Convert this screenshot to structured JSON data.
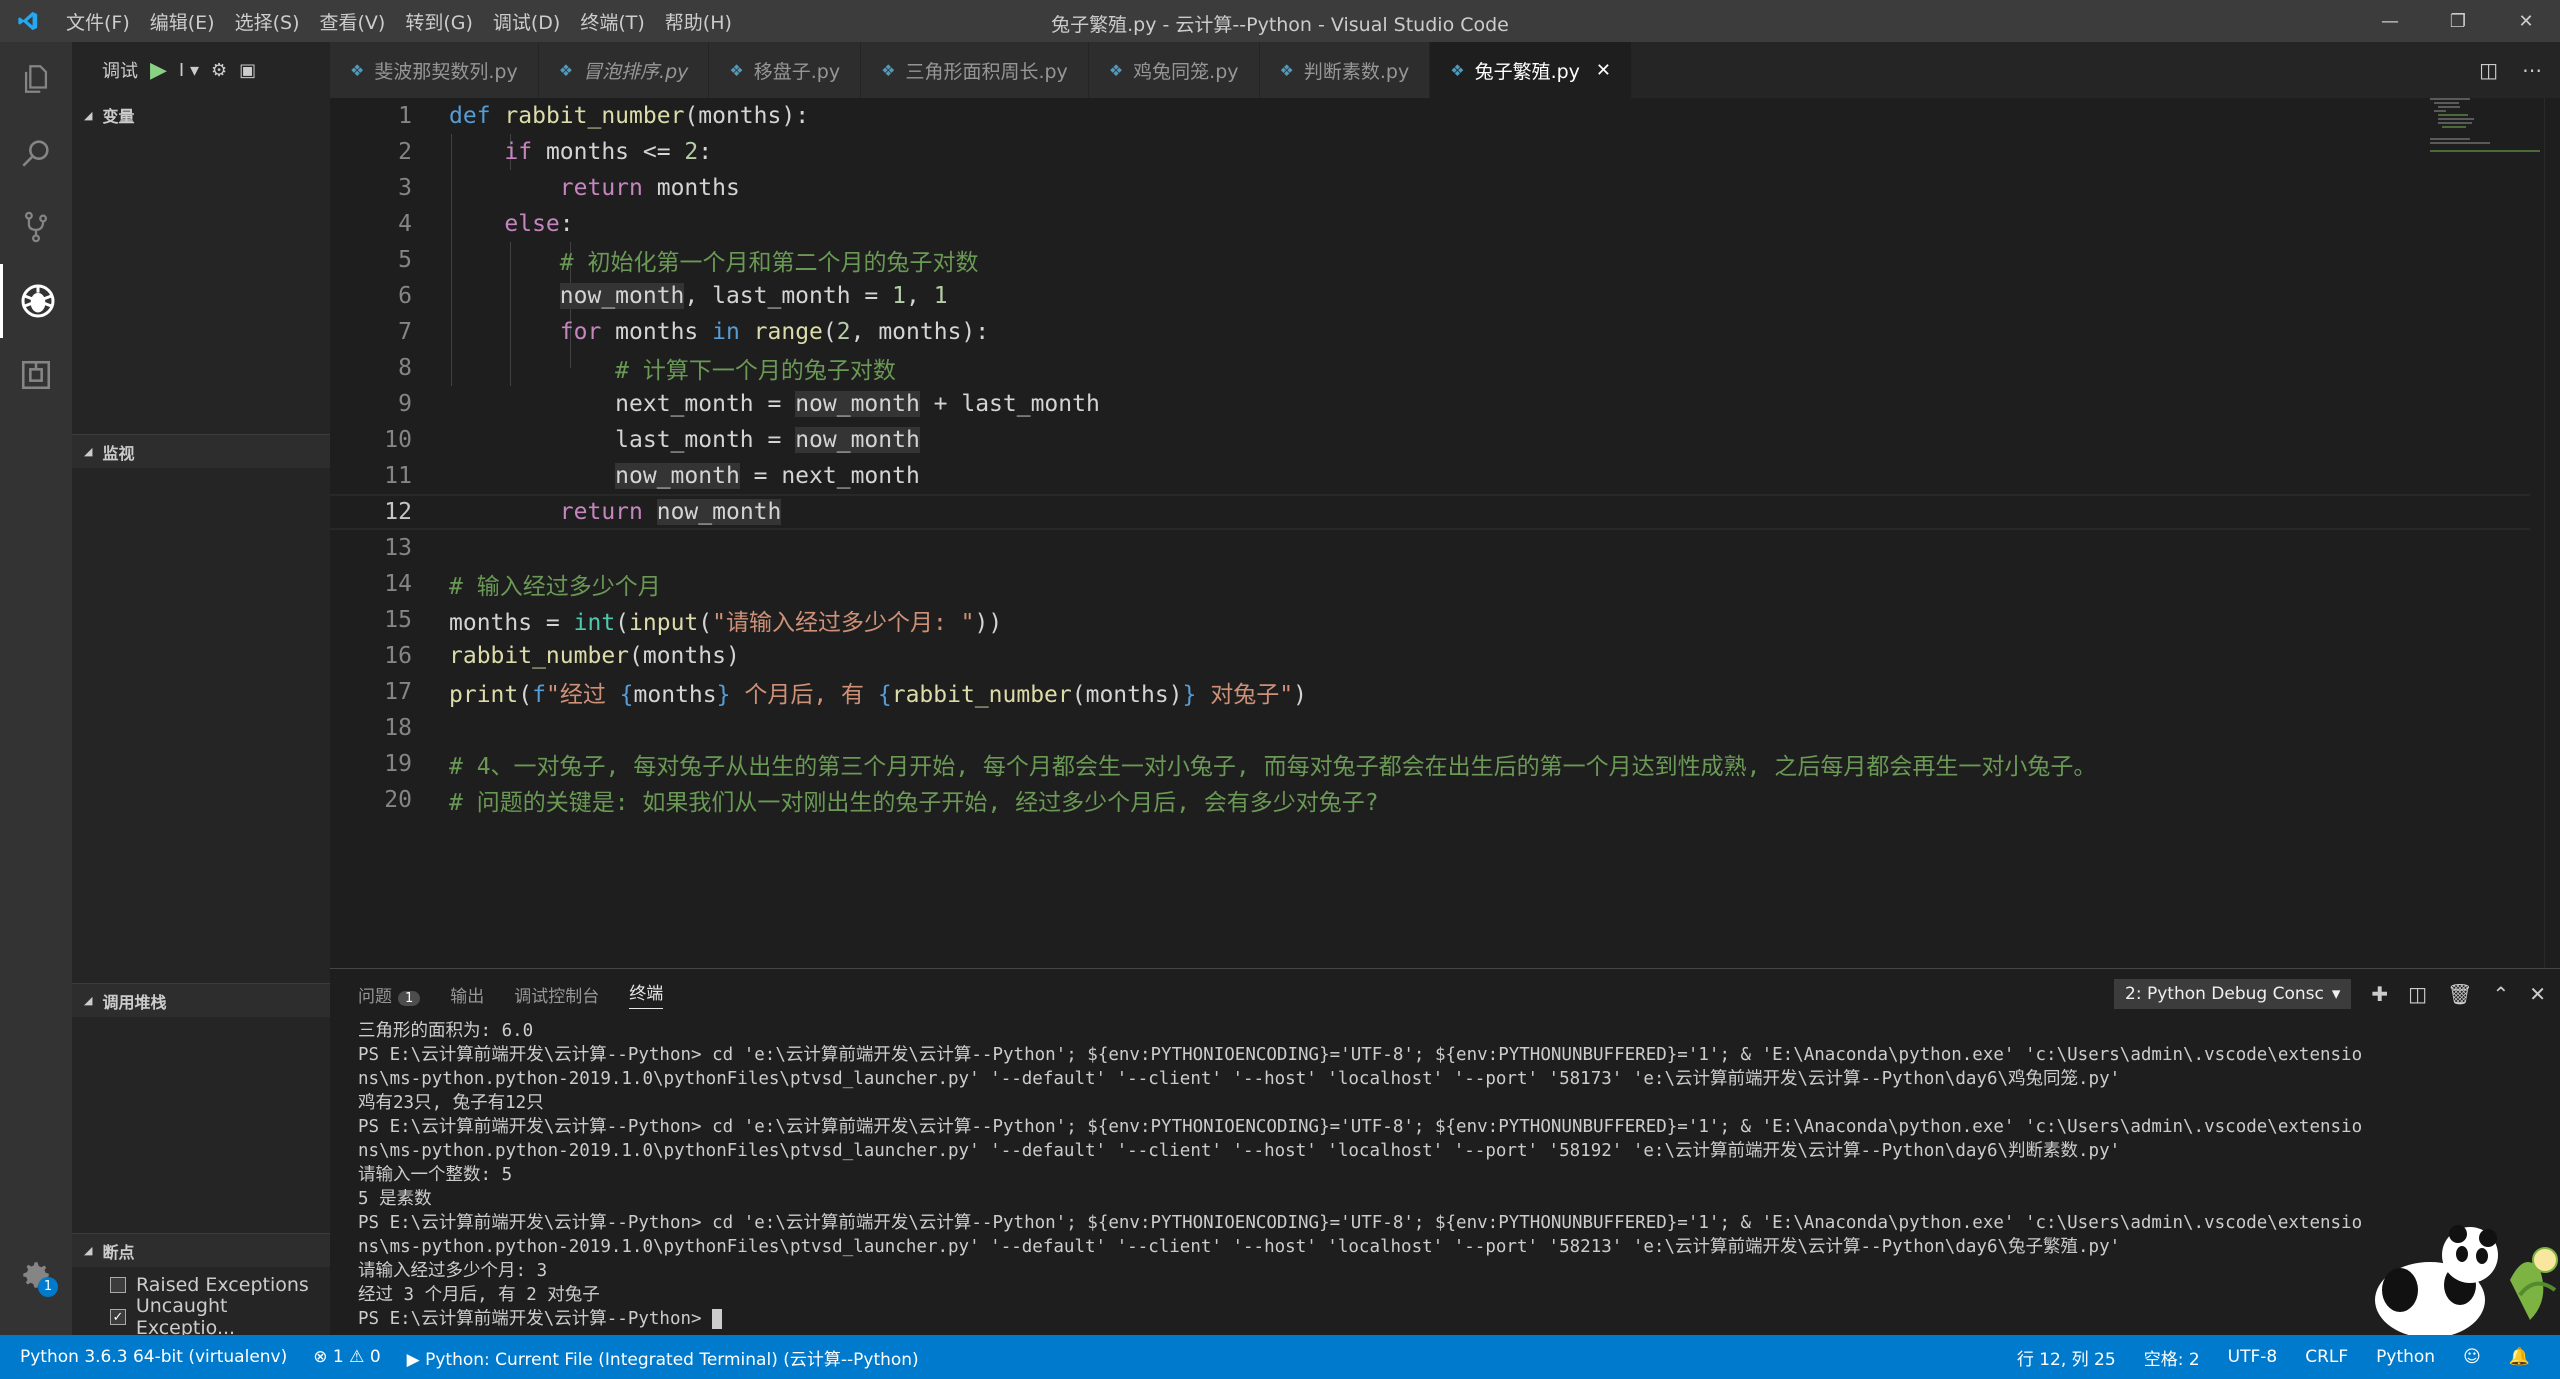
{
  "window": {
    "title": "兔子繁殖.py - 云计算--Python - Visual Studio Code",
    "menu": [
      "文件(F)",
      "编辑(E)",
      "选择(S)",
      "查看(V)",
      "转到(G)",
      "调试(D)",
      "终端(T)",
      "帮助(H)"
    ]
  },
  "debug_toolbar": {
    "label": "调试",
    "config": "I"
  },
  "sidebar": {
    "variables": "变量",
    "watch": "监视",
    "callstack": "调用堆栈",
    "breakpoints": "断点",
    "bp_items": [
      {
        "label": "Raised Exceptions",
        "checked": false
      },
      {
        "label": "Uncaught Exceptio...",
        "checked": true
      }
    ]
  },
  "tabs": [
    {
      "label": "斐波那契数列.py",
      "active": false,
      "italic": false
    },
    {
      "label": "冒泡排序.py",
      "active": false,
      "italic": true
    },
    {
      "label": "移盘子.py",
      "active": false,
      "italic": false
    },
    {
      "label": "三角形面积周长.py",
      "active": false,
      "italic": false
    },
    {
      "label": "鸡兔同笼.py",
      "active": false,
      "italic": false
    },
    {
      "label": "判断素数.py",
      "active": false,
      "italic": false
    },
    {
      "label": "兔子繁殖.py",
      "active": true,
      "italic": false
    }
  ],
  "editor": {
    "current_line": 12,
    "lines": [
      "def rabbit_number(months):",
      "    if months <= 2:",
      "        return months",
      "    else:",
      "        # 初始化第一个月和第二个月的兔子对数",
      "        now_month, last_month = 1, 1",
      "        for months in range(2, months):",
      "            # 计算下一个月的兔子对数",
      "            next_month = now_month + last_month",
      "            last_month = now_month",
      "            now_month = next_month",
      "        return now_month",
      "",
      "# 输入经过多少个月",
      "months = int(input(\"请输入经过多少个月: \"))",
      "rabbit_number(months)",
      "print(f\"经过 {months} 个月后, 有 {rabbit_number(months)} 对兔子\")",
      "",
      "# 4、一对兔子, 每对兔子从出生的第三个月开始, 每个月都会生一对小兔子, 而每对兔子都会在出生后的第一个月达到性成熟, 之后每月都会再生一对小兔子。",
      "# 问题的关键是: 如果我们从一对刚出生的兔子开始, 经过多少个月后, 会有多少对兔子?"
    ]
  },
  "panel": {
    "tabs": [
      {
        "label": "问题",
        "count": "1"
      },
      {
        "label": "输出"
      },
      {
        "label": "调试控制台"
      },
      {
        "label": "终端",
        "active": true
      }
    ],
    "terminal_select": "2: Python Debug Consc",
    "terminal_lines": [
      "三角形的面积为: 6.0",
      "PS E:\\云计算前端开发\\云计算--Python> cd 'e:\\云计算前端开发\\云计算--Python'; ${env:PYTHONIOENCODING}='UTF-8'; ${env:PYTHONUNBUFFERED}='1'; & 'E:\\Anaconda\\python.exe' 'c:\\Users\\admin\\.vscode\\extensio",
      "ns\\ms-python.python-2019.1.0\\pythonFiles\\ptvsd_launcher.py' '--default' '--client' '--host' 'localhost' '--port' '58173' 'e:\\云计算前端开发\\云计算--Python\\day6\\鸡兔同笼.py'",
      "鸡有23只, 兔子有12只",
      "PS E:\\云计算前端开发\\云计算--Python> cd 'e:\\云计算前端开发\\云计算--Python'; ${env:PYTHONIOENCODING}='UTF-8'; ${env:PYTHONUNBUFFERED}='1'; & 'E:\\Anaconda\\python.exe' 'c:\\Users\\admin\\.vscode\\extensio",
      "ns\\ms-python.python-2019.1.0\\pythonFiles\\ptvsd_launcher.py' '--default' '--client' '--host' 'localhost' '--port' '58192' 'e:\\云计算前端开发\\云计算--Python\\day6\\判断素数.py'",
      "请输入一个整数: 5",
      "5 是素数",
      "PS E:\\云计算前端开发\\云计算--Python> cd 'e:\\云计算前端开发\\云计算--Python'; ${env:PYTHONIOENCODING}='UTF-8'; ${env:PYTHONUNBUFFERED}='1'; & 'E:\\Anaconda\\python.exe' 'c:\\Users\\admin\\.vscode\\extensio",
      "ns\\ms-python.python-2019.1.0\\pythonFiles\\ptvsd_launcher.py' '--default' '--client' '--host' 'localhost' '--port' '58213' 'e:\\云计算前端开发\\云计算--Python\\day6\\兔子繁殖.py'",
      "请输入经过多少个月: 3",
      "经过 3 个月后, 有 2 对兔子",
      "PS E:\\云计算前端开发\\云计算--Python> "
    ]
  },
  "statusbar": {
    "interpreter": "Python 3.6.3 64-bit (virtualenv)",
    "errors": "1",
    "warnings": "0",
    "launch": "Python: Current File (Integrated Terminal) (云计算--Python)",
    "position": "行 12, 列 25",
    "indent": "空格: 2",
    "encoding": "UTF-8",
    "eol": "CRLF",
    "language": "Python"
  },
  "activity_badge": "1",
  "colors": {
    "statusbar": "#007acc",
    "keyword": "#569cd6",
    "comment": "#6a9955",
    "string": "#ce9178",
    "function": "#dcdcaa"
  }
}
